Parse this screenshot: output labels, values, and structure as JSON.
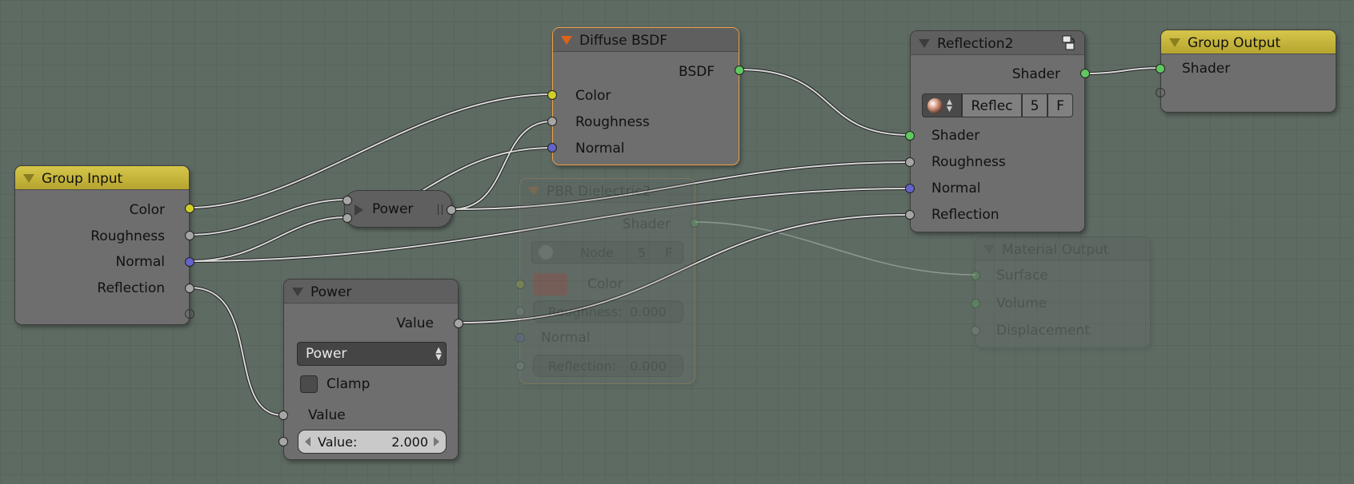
{
  "group_input": {
    "title": "Group Input",
    "outputs": [
      "Color",
      "Roughness",
      "Normal",
      "Reflection"
    ]
  },
  "reroute_power": {
    "label": "Power"
  },
  "power_node": {
    "title": "Power",
    "output": "Value",
    "operation": "Power",
    "clamp_label": "Clamp",
    "clamp_checked": false,
    "input_value_label": "Value",
    "field_label": "Value:",
    "field_value": "2.000"
  },
  "diffuse_bsdf": {
    "title": "Diffuse BSDF",
    "output": "BSDF",
    "inputs": [
      "Color",
      "Roughness",
      "Normal"
    ]
  },
  "pbr_dielectric": {
    "title": "PBR Dielectric2",
    "output": "Shader",
    "node_label": "Node",
    "node_users": "5",
    "node_fake": "F",
    "color_label": "Color",
    "roughness_label": "Roughness:",
    "roughness_value": "0.000",
    "normal_label": "Normal",
    "reflection_label": "Reflection:",
    "reflection_value": "0.000"
  },
  "reflection2": {
    "title": "Reflection2",
    "output": "Shader",
    "group_name": "Reflec",
    "group_users": "5",
    "group_fake": "F",
    "inputs": [
      "Shader",
      "Roughness",
      "Normal",
      "Reflection"
    ]
  },
  "group_output": {
    "title": "Group Output",
    "inputs": [
      "Shader"
    ]
  },
  "material_output": {
    "title": "Material Output",
    "inputs": [
      "Surface",
      "Volume",
      "Displacement"
    ]
  },
  "colors": {
    "background": "#5e6b63",
    "node_body": "#6e6e6e",
    "group_header": "#c8b83c",
    "selected_outline": "#f0a040",
    "socket_color": "#cfcf2a",
    "socket_float": "#a5a5a5",
    "socket_vector": "#6363c8",
    "socket_shader": "#5fc85f"
  }
}
